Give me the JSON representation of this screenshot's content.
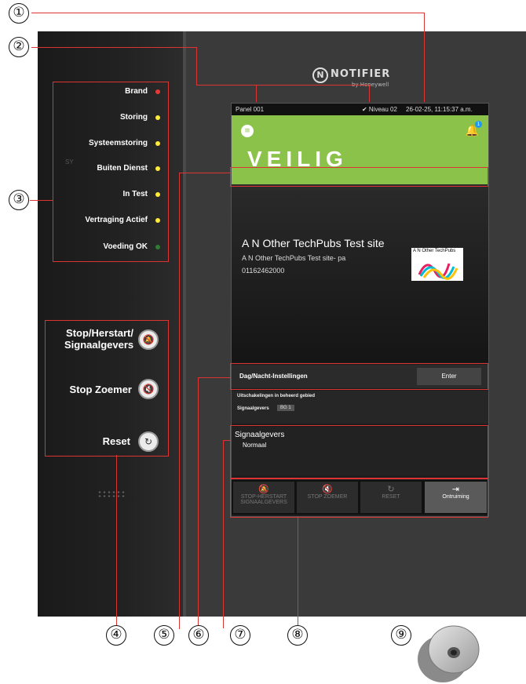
{
  "logo": {
    "brand": "NOTIFIER",
    "sub": "by Honeywell",
    "mark": "N"
  },
  "leds": [
    {
      "label": "Brand",
      "color": "#e53935"
    },
    {
      "label": "Storing",
      "color": "#ffeb3b"
    },
    {
      "label": "Systeemstoring",
      "color": "#ffeb3b"
    },
    {
      "label": "Buiten Dienst",
      "color": "#ffeb3b"
    },
    {
      "label": "In Test",
      "color": "#ffeb3b"
    },
    {
      "label": "Vertraging Actief",
      "color": "#ffeb3b"
    },
    {
      "label": "Voeding OK",
      "color": "#2e7d32"
    }
  ],
  "ghost_text": "SY",
  "hw_buttons": {
    "stop_herstart_1": "Stop/Herstart/",
    "stop_herstart_2": "Signaalgevers",
    "stop_zoemer": "Stop Zoemer",
    "reset": "Reset"
  },
  "screen": {
    "panel": "Panel 001",
    "level": "✔ Niveau 02",
    "datetime": "26-02-25, 11:15:37 a.m.",
    "status": "VEILIG",
    "notification_count": "1",
    "site_title": "A N Other TechPubs Test site",
    "site_subtitle": "A N Other TechPubs Test site- pa",
    "site_phone": "01162462000",
    "site_logo_text": "A N Other TechPubs",
    "daynight_label": "Dag/Nacht-Instellingen",
    "enter_label": "Enter",
    "disable_heading": "Uitschakelingen in beheerd gebied",
    "disable_row_label": "Signaalgevers",
    "disable_row_chip": "BG 1",
    "sig_heading": "Signaalgevers",
    "sig_status": "Normaal",
    "actions": [
      {
        "label": "STOP-HERSTART SIGNAALGEVERS",
        "icon": "bell-off-icon"
      },
      {
        "label": "STOP ZOEMER",
        "icon": "speaker-mute-icon"
      },
      {
        "label": "RESET",
        "icon": "reset-icon"
      },
      {
        "label": "Ontruiming",
        "icon": "evacuation-icon"
      }
    ]
  },
  "callouts": [
    "①",
    "②",
    "③",
    "④",
    "⑤",
    "⑥",
    "⑦",
    "⑧",
    "⑨"
  ],
  "colors": {
    "safe_green": "#8bc34a",
    "annotation_red": "#dd3333"
  }
}
